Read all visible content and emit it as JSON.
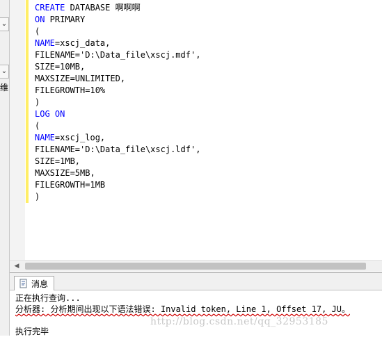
{
  "left_panel": {
    "dropdown1_glyph": "⌄",
    "dropdown2_glyph": "⌄",
    "partial_label": "维"
  },
  "editor": {
    "lines": [
      [
        {
          "t": "CREATE",
          "kw": true
        },
        {
          "t": " DATABASE 啊啊啊",
          "kw": false
        }
      ],
      [
        {
          "t": "ON",
          "kw": true
        },
        {
          "t": " PRIMARY",
          "kw": false
        }
      ],
      [
        {
          "t": "(",
          "kw": false
        }
      ],
      [
        {
          "t": "NAME",
          "kw": true
        },
        {
          "t": "=xscj_data,",
          "kw": false
        }
      ],
      [
        {
          "t": "FILENAME='D:\\Data_file\\xscj.mdf',",
          "kw": false
        }
      ],
      [
        {
          "t": "SIZE=10MB,",
          "kw": false
        }
      ],
      [
        {
          "t": "MAXSIZE=UNLIMITED,",
          "kw": false
        }
      ],
      [
        {
          "t": "FILEGROWTH=10%",
          "kw": false
        }
      ],
      [
        {
          "t": ")",
          "kw": false
        }
      ],
      [
        {
          "t": "LOG",
          "kw": true
        },
        {
          "t": " ",
          "kw": false
        },
        {
          "t": "ON",
          "kw": true
        }
      ],
      [
        {
          "t": "(",
          "kw": false
        }
      ],
      [
        {
          "t": "NAME",
          "kw": true
        },
        {
          "t": "=xscj_log,",
          "kw": false
        }
      ],
      [
        {
          "t": "FILENAME='D:\\Data_file\\xscj.ldf',",
          "kw": false
        }
      ],
      [
        {
          "t": "SIZE=1MB,",
          "kw": false
        }
      ],
      [
        {
          "t": "MAXSIZE=5MB,",
          "kw": false
        }
      ],
      [
        {
          "t": "FILEGROWTH=1MB",
          "kw": false
        }
      ],
      [
        {
          "t": ")",
          "kw": false
        }
      ]
    ]
  },
  "colors": {
    "keyword": "#0000ff",
    "change_bar": "#ffee66",
    "error_underline": "#d00000"
  },
  "hscroll": {
    "left_arrow": "◀"
  },
  "messages": {
    "tab_label": "消息",
    "tab_icon": "document-info-icon",
    "line1": "正在执行查询...",
    "line2": "分析器: 分析期间出现以下语法错误: Invalid token, Line 1, Offset 17, JU。",
    "line3": "",
    "line4": "执行完毕"
  },
  "watermark": "http://blog.csdn.net/qq_32953185"
}
